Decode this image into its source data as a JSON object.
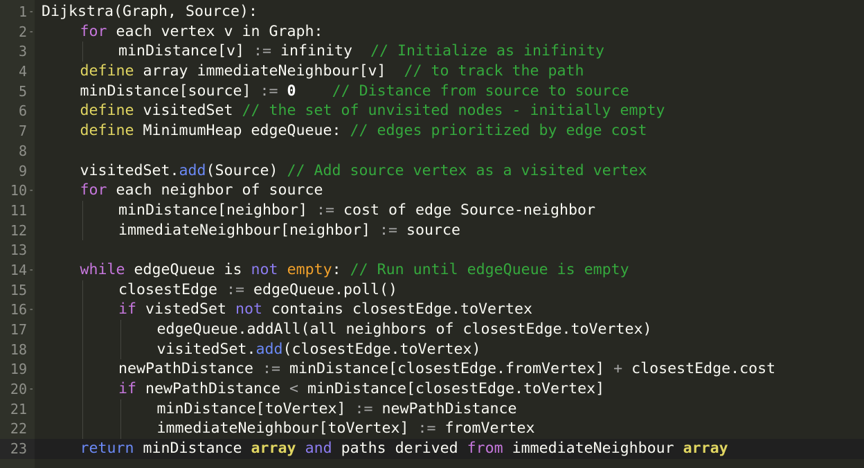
{
  "editor": {
    "lines": [
      {
        "n": "1",
        "fold": true,
        "indent": 0,
        "segs": [
          {
            "t": "Dijkstra(Graph, Source):",
            "c": ""
          }
        ]
      },
      {
        "n": "2",
        "fold": true,
        "indent": 1,
        "segs": [
          {
            "t": "for",
            "c": "t-for"
          },
          {
            "t": " each vertex v in Graph:",
            "c": ""
          }
        ]
      },
      {
        "n": "3",
        "fold": false,
        "indent": 2,
        "segs": [
          {
            "t": "minDistance[v] ",
            "c": ""
          },
          {
            "t": ":=",
            "c": "t-op"
          },
          {
            "t": " infinity  ",
            "c": ""
          },
          {
            "t": "// Initialize as inifinity",
            "c": "t-cmt"
          }
        ]
      },
      {
        "n": "4",
        "fold": false,
        "indent": 1,
        "segs": [
          {
            "t": "define",
            "c": "t-def"
          },
          {
            "t": " array immediateNeighbour[v]  ",
            "c": ""
          },
          {
            "t": "// to track the path",
            "c": "t-cmt"
          }
        ]
      },
      {
        "n": "5",
        "fold": false,
        "indent": 1,
        "segs": [
          {
            "t": "minDistance[source] ",
            "c": ""
          },
          {
            "t": ":=",
            "c": "t-op"
          },
          {
            "t": " ",
            "c": ""
          },
          {
            "t": "0",
            "c": "t-num"
          },
          {
            "t": "    ",
            "c": ""
          },
          {
            "t": "// Distance from source to source",
            "c": "t-cmt"
          }
        ]
      },
      {
        "n": "6",
        "fold": false,
        "indent": 1,
        "segs": [
          {
            "t": "define",
            "c": "t-def"
          },
          {
            "t": " visitedSet ",
            "c": ""
          },
          {
            "t": "// the set of unvisited nodes - initially empty",
            "c": "t-cmt"
          }
        ]
      },
      {
        "n": "7",
        "fold": false,
        "indent": 1,
        "segs": [
          {
            "t": "define",
            "c": "t-def"
          },
          {
            "t": " MinimumHeap edgeQueue: ",
            "c": ""
          },
          {
            "t": "// edges prioritized by edge cost",
            "c": "t-cmt"
          }
        ]
      },
      {
        "n": "8",
        "fold": false,
        "indent": 0,
        "segs": []
      },
      {
        "n": "9",
        "fold": false,
        "indent": 1,
        "segs": [
          {
            "t": "visitedSet.",
            "c": ""
          },
          {
            "t": "add",
            "c": "t-fn"
          },
          {
            "t": "(Source) ",
            "c": ""
          },
          {
            "t": "// Add source vertex as a visited vertex",
            "c": "t-cmt"
          }
        ]
      },
      {
        "n": "10",
        "fold": true,
        "indent": 1,
        "segs": [
          {
            "t": "for",
            "c": "t-for"
          },
          {
            "t": " each neighbor of source",
            "c": ""
          }
        ]
      },
      {
        "n": "11",
        "fold": false,
        "indent": 2,
        "segs": [
          {
            "t": "minDistance[neighbor] ",
            "c": ""
          },
          {
            "t": ":=",
            "c": "t-op"
          },
          {
            "t": " cost of edge Source-neighbor",
            "c": ""
          }
        ]
      },
      {
        "n": "12",
        "fold": false,
        "indent": 2,
        "segs": [
          {
            "t": "immediateNeighbour[neighbor] ",
            "c": ""
          },
          {
            "t": ":=",
            "c": "t-op"
          },
          {
            "t": " source",
            "c": ""
          }
        ]
      },
      {
        "n": "13",
        "fold": false,
        "indent": 0,
        "segs": []
      },
      {
        "n": "14",
        "fold": true,
        "indent": 1,
        "segs": [
          {
            "t": "while",
            "c": "t-while"
          },
          {
            "t": " edgeQueue is ",
            "c": ""
          },
          {
            "t": "not",
            "c": "t-and"
          },
          {
            "t": " ",
            "c": ""
          },
          {
            "t": "empty",
            "c": "t-empty"
          },
          {
            "t": ": ",
            "c": ""
          },
          {
            "t": "// Run until edgeQueue is empty",
            "c": "t-cmt"
          }
        ]
      },
      {
        "n": "15",
        "fold": false,
        "indent": 2,
        "segs": [
          {
            "t": "closestEdge ",
            "c": ""
          },
          {
            "t": ":=",
            "c": "t-op"
          },
          {
            "t": " edgeQueue.poll()",
            "c": ""
          }
        ]
      },
      {
        "n": "16",
        "fold": true,
        "indent": 2,
        "segs": [
          {
            "t": "if",
            "c": "t-for"
          },
          {
            "t": " vistedSet ",
            "c": ""
          },
          {
            "t": "not",
            "c": "t-and"
          },
          {
            "t": " contains closestEdge.toVertex",
            "c": ""
          }
        ]
      },
      {
        "n": "17",
        "fold": false,
        "indent": 3,
        "segs": [
          {
            "t": "edgeQueue.addAll(all neighbors of closestEdge.toVertex)",
            "c": ""
          }
        ]
      },
      {
        "n": "18",
        "fold": false,
        "indent": 3,
        "segs": [
          {
            "t": "visitedSet.",
            "c": ""
          },
          {
            "t": "add",
            "c": "t-fn"
          },
          {
            "t": "(closestEdge.toVertex)",
            "c": ""
          }
        ]
      },
      {
        "n": "19",
        "fold": false,
        "indent": 2,
        "segs": [
          {
            "t": "newPathDistance ",
            "c": ""
          },
          {
            "t": ":=",
            "c": "t-op"
          },
          {
            "t": " minDistance[closestEdge.fromVertex] ",
            "c": ""
          },
          {
            "t": "+",
            "c": "t-op"
          },
          {
            "t": " closestEdge.cost",
            "c": ""
          }
        ]
      },
      {
        "n": "20",
        "fold": true,
        "indent": 2,
        "segs": [
          {
            "t": "if",
            "c": "t-for"
          },
          {
            "t": " newPathDistance ",
            "c": ""
          },
          {
            "t": "<",
            "c": "t-op"
          },
          {
            "t": " minDistance[closestEdge.toVertex]",
            "c": ""
          }
        ]
      },
      {
        "n": "21",
        "fold": false,
        "indent": 3,
        "segs": [
          {
            "t": "minDistance[toVertex] ",
            "c": ""
          },
          {
            "t": ":=",
            "c": "t-op"
          },
          {
            "t": " newPathDistance",
            "c": ""
          }
        ]
      },
      {
        "n": "22",
        "fold": false,
        "indent": 3,
        "segs": [
          {
            "t": "immediateNeighbour[toVertex] ",
            "c": ""
          },
          {
            "t": ":=",
            "c": "t-op"
          },
          {
            "t": " fromVertex",
            "c": ""
          }
        ]
      },
      {
        "n": "23",
        "fold": false,
        "indent": 1,
        "active": true,
        "segs": [
          {
            "t": "return",
            "c": "t-fn"
          },
          {
            "t": " minDistance ",
            "c": ""
          },
          {
            "t": "array",
            "c": "t-def t-bold"
          },
          {
            "t": " ",
            "c": ""
          },
          {
            "t": "and",
            "c": "t-and"
          },
          {
            "t": " paths derived ",
            "c": ""
          },
          {
            "t": "from",
            "c": "t-for"
          },
          {
            "t": " immediateNeighbour ",
            "c": ""
          },
          {
            "t": "array",
            "c": "t-def t-bold"
          }
        ]
      }
    ]
  },
  "colors": {
    "background": "#272822",
    "gutter": "#2f3129",
    "comment": "#35a83d",
    "keyword_for": "#c677dd",
    "keyword_define": "#e0d561",
    "function": "#6b89f5"
  }
}
